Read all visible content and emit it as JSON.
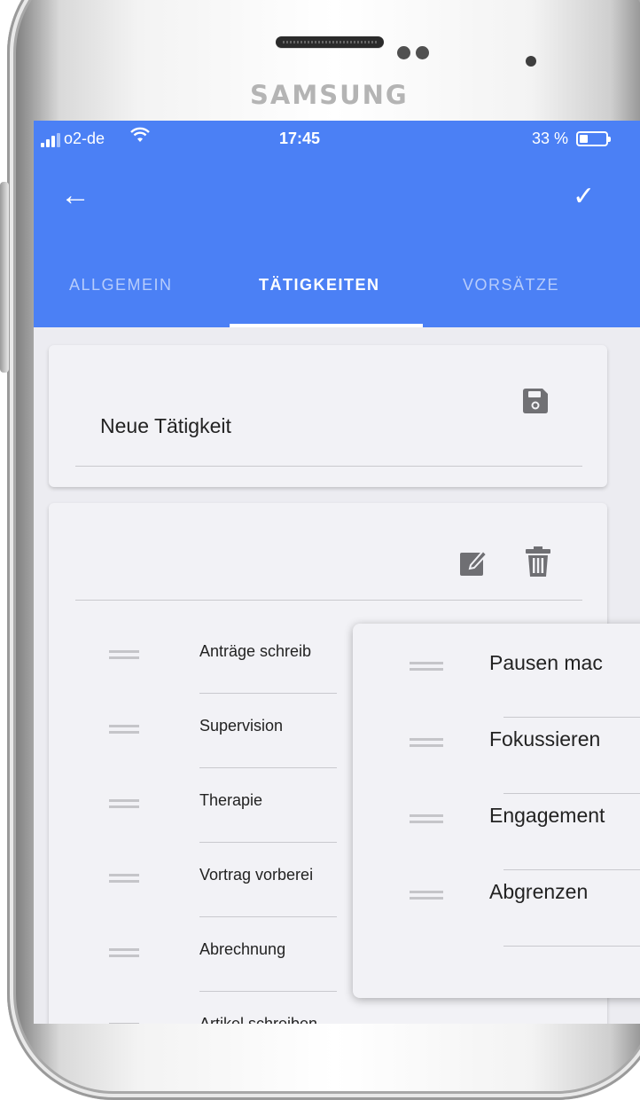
{
  "device": {
    "brand": "SAMSUNG"
  },
  "status_bar": {
    "carrier": "o2-de",
    "time": "17:45",
    "battery": "33 %",
    "battery_level": 0.33
  },
  "tabs": [
    {
      "label": "ALLGEMEIN",
      "active": false
    },
    {
      "label": "TÄTIGKEITEN",
      "active": true
    },
    {
      "label": "VORSÄTZE",
      "active": false
    }
  ],
  "new_activity": {
    "label": "Neue Tätigkeit"
  },
  "activities": [
    {
      "label": "Anträge schreib"
    },
    {
      "label": "Supervision"
    },
    {
      "label": "Therapie"
    },
    {
      "label": "Vortrag vorberei"
    },
    {
      "label": "Abrechnung"
    },
    {
      "label": "Artikel schreiben"
    }
  ],
  "popup": {
    "items": [
      {
        "label": "Pausen mac"
      },
      {
        "label": "Fokussieren"
      },
      {
        "label": "Engagement"
      },
      {
        "label": "Abgrenzen"
      }
    ]
  },
  "icons": {
    "back": "arrow-left-icon",
    "confirm": "check-icon",
    "save": "floppy-disk-icon",
    "edit": "pencil-icon",
    "delete": "trash-icon",
    "drag": "drag-handle-icon",
    "share": "share-icon"
  },
  "colors": {
    "appbar": "#4b80f5",
    "background": "#ececf1",
    "card": "#f2f2f6"
  }
}
